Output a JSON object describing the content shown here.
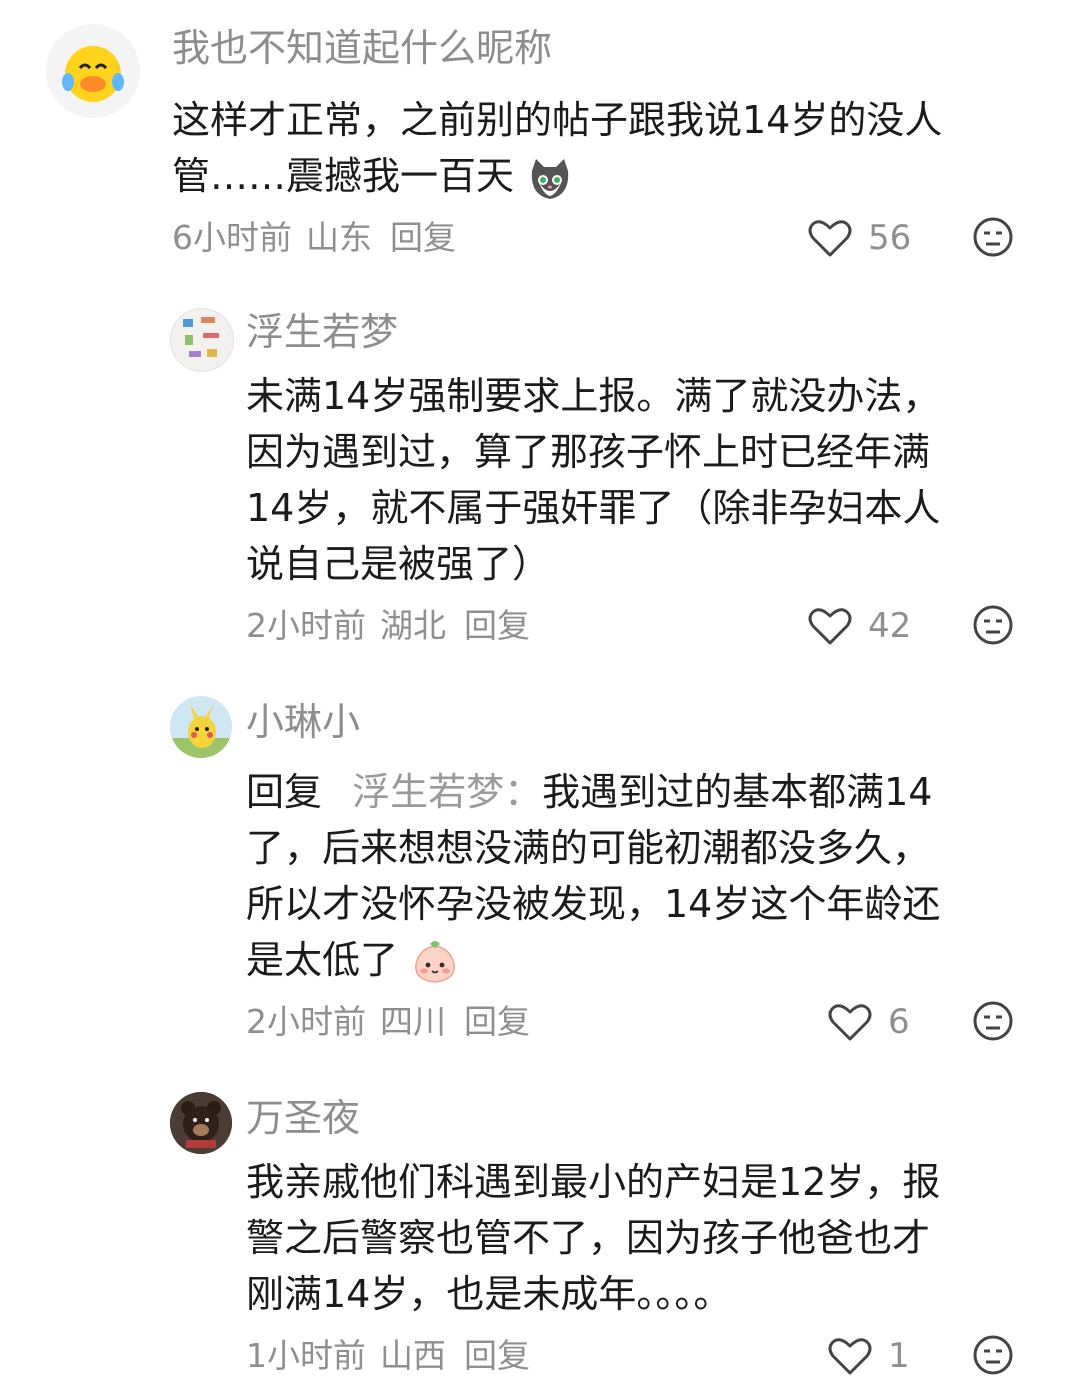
{
  "comments": [
    {
      "nickname": "我也不知道起什么昵称",
      "text_lines": [
        "这样才正常，之前别的帖子跟我说14岁的没人",
        "管……震撼我一百天"
      ],
      "time": "6小时前",
      "location": "山东",
      "reply_label": "回复",
      "likes": "56",
      "avatar_icon": "laughing-duck-icon"
    },
    {
      "nickname": "浮生若梦",
      "text_lines": [
        "未满14岁强制要求上报。满了就没办法，",
        "因为遇到过，算了那孩子怀上时已经年满",
        "14岁，就不属于强奸罪了（除非孕妇本人",
        "说自己是被强了）"
      ],
      "time": "2小时前",
      "location": "湖北",
      "reply_label": "回复",
      "likes": "42",
      "avatar_icon": "sticker-collage-icon"
    },
    {
      "nickname": "小琳小",
      "reply_prefix": "回复",
      "reply_to": "浮生若梦：",
      "text_lines": [
        "我遇到过的基本都满14",
        "了，后来想想没满的可能初潮都没多久，",
        "所以才没怀孕没被发现，14岁这个年龄还",
        "是太低了"
      ],
      "time": "2小时前",
      "location": "四川",
      "reply_label": "回复",
      "likes": "6",
      "avatar_icon": "pikachu-avatar-icon"
    },
    {
      "nickname": "万圣夜",
      "text_lines": [
        "我亲戚他们科遇到最小的产妇是12岁，报",
        "警之后警察也管不了，因为孩子他爸也才",
        "刚满14岁，也是未成年。。。。"
      ],
      "time": "1小时前",
      "location": "山西",
      "reply_label": "回复",
      "likes": "1",
      "avatar_icon": "bear-avatar-icon"
    }
  ],
  "colors": {
    "text": "#1b1b1b",
    "muted": "#8f8f8f",
    "nickname": "#8d8d8d"
  }
}
